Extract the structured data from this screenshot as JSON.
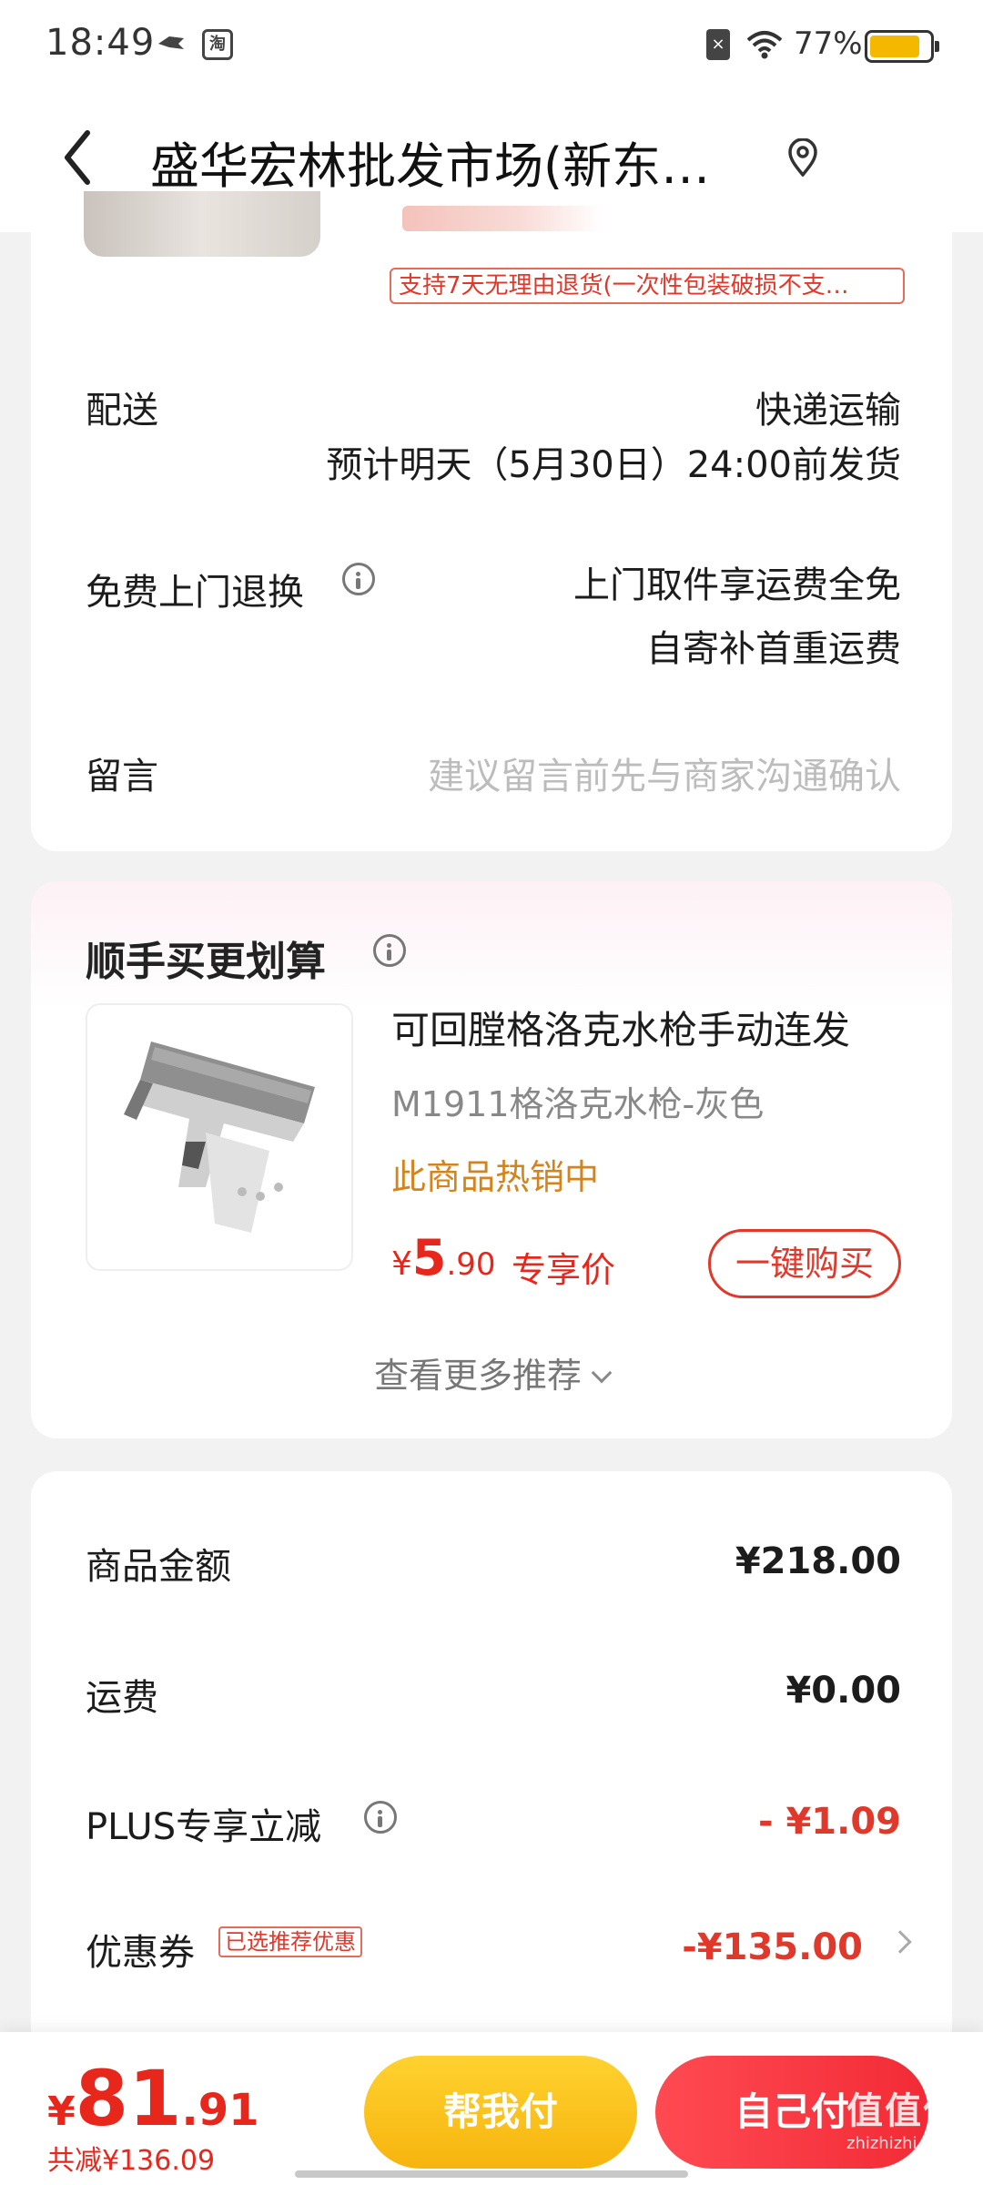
{
  "status_bar": {
    "time": "18:49",
    "app_badge": "淘",
    "sim_glyph": "×",
    "battery_percent": "77%",
    "battery_level": 0.77
  },
  "header": {
    "title": "盛华宏林批发市场(新东…"
  },
  "order_item": {
    "return_policy_tag": "支持7天无理由退货(一次性包装破损不支…"
  },
  "delivery": {
    "label": "配送",
    "method": "快递运输",
    "estimate": "预计明天（5月30日）24:00前发货"
  },
  "free_return": {
    "label": "免费上门退换",
    "line1": "上门取件享运费全免",
    "line2": "自寄补首重运费"
  },
  "message": {
    "label": "留言",
    "placeholder": "建议留言前先与商家沟通确认"
  },
  "upsell": {
    "title": "顺手买更划算",
    "product": {
      "name": "可回膛格洛克水枪手动连发",
      "variant": "M1911格洛克水枪-灰色",
      "hot_label": "此商品热销中",
      "currency": "¥",
      "price_int": "5",
      "price_dec": ".90",
      "price_label": "专享价",
      "buy_button": "一键购买"
    },
    "more_link": "查看更多推荐"
  },
  "summary": {
    "goods_label": "商品金额",
    "goods_value": "¥218.00",
    "shipping_label": "运费",
    "shipping_value": "¥0.00",
    "plus_label": "PLUS专享立减",
    "plus_value": "- ¥1.09",
    "coupon_label": "优惠券",
    "coupon_badge": "已选推荐优惠",
    "coupon_value": "-¥135.00"
  },
  "bottom_bar": {
    "currency": "¥",
    "total_int": "81",
    "total_dec": ".91",
    "saved": "共减¥136.09",
    "help_pay_button": "帮我付",
    "self_pay_button": "自己付"
  },
  "watermark": {
    "glyphs": "值值值",
    "domain": "zhizhizhi.com"
  },
  "colors": {
    "accent_red": "#e8271c",
    "help_pay_yellow": "#f7b40e",
    "hot_orange": "#d4841c"
  }
}
